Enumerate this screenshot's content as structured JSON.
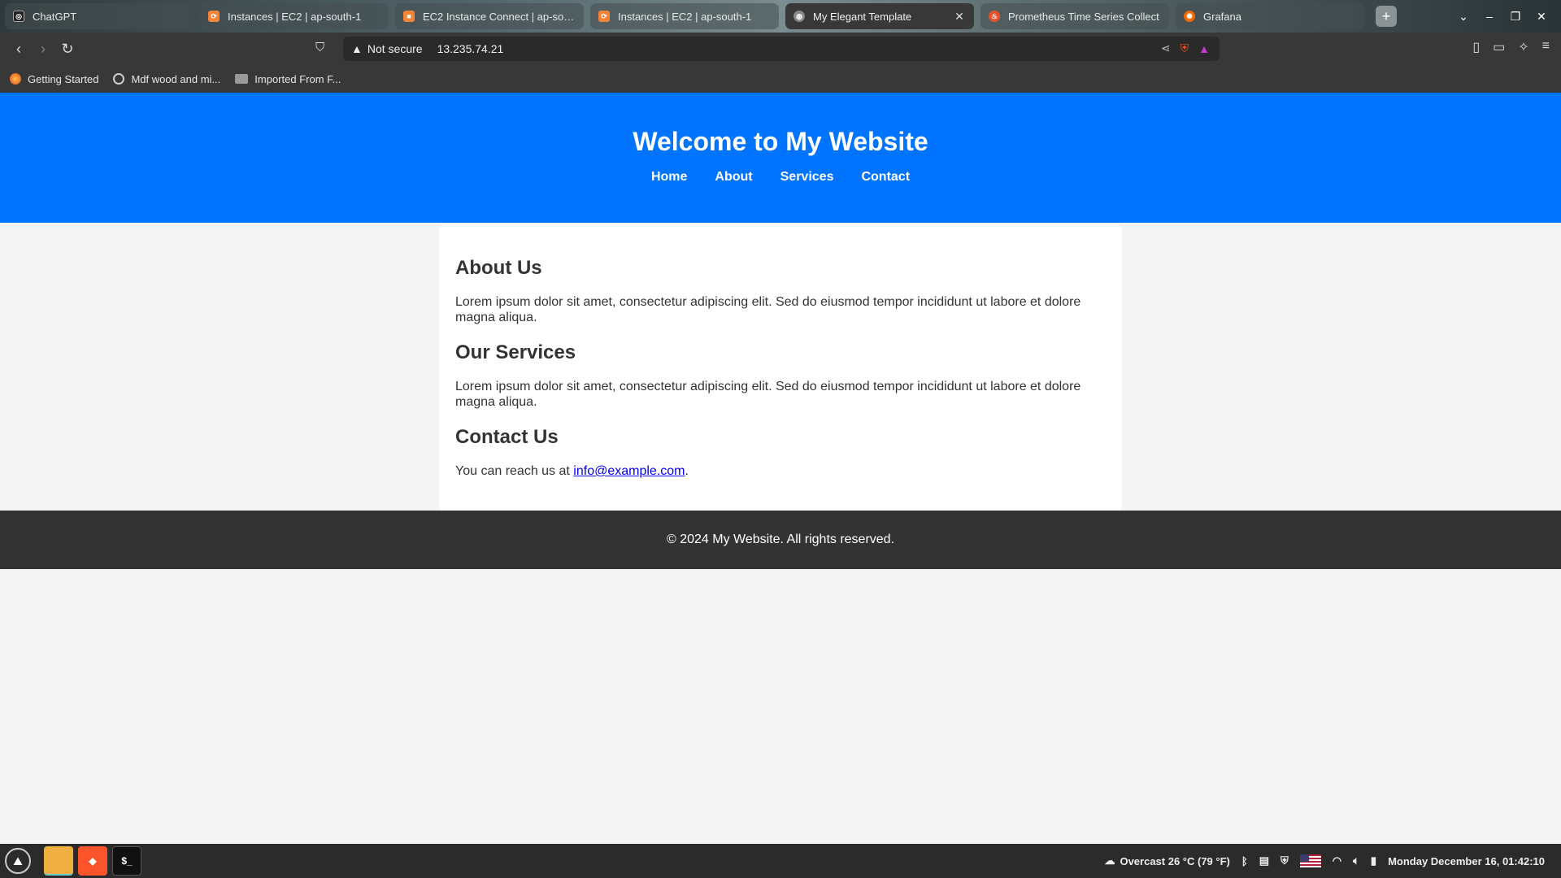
{
  "browser": {
    "tabs": [
      {
        "title": "ChatGPT",
        "favicon": "chatgpt-icon",
        "color": "#202020"
      },
      {
        "title": "Instances | EC2 | ap-south-1",
        "favicon": "aws-icon",
        "color": "#f58536"
      },
      {
        "title": "EC2 Instance Connect | ap-south-1",
        "favicon": "aws-cube-icon",
        "color": "#f58536"
      },
      {
        "title": "Instances | EC2 | ap-south-1",
        "favicon": "aws-icon",
        "color": "#f58536"
      },
      {
        "title": "My Elegant Template",
        "favicon": "globe-icon",
        "color": "#888888",
        "active": true
      },
      {
        "title": "Prometheus Time Series Collect",
        "favicon": "prometheus-icon",
        "color": "#e6522c"
      },
      {
        "title": "Grafana",
        "favicon": "grafana-icon",
        "color": "#f46800"
      }
    ],
    "new_tab": "+",
    "address": {
      "security": "Not secure",
      "url": "13.235.74.21"
    },
    "bookmarks": [
      {
        "label": "Getting Started",
        "icon": "firefox-icon"
      },
      {
        "label": "Mdf wood and mi...",
        "icon": "globe-icon"
      },
      {
        "label": "Imported From F...",
        "icon": "folder-icon"
      }
    ]
  },
  "page": {
    "title": "Welcome to My Website",
    "nav": [
      "Home",
      "About",
      "Services",
      "Contact"
    ],
    "about_heading": "About Us",
    "about_text": "Lorem ipsum dolor sit amet, consectetur adipiscing elit. Sed do eiusmod tempor incididunt ut labore et dolore magna aliqua.",
    "services_heading": "Our Services",
    "services_text": "Lorem ipsum dolor sit amet, consectetur adipiscing elit. Sed do eiusmod tempor incididunt ut labore et dolore magna aliqua.",
    "contact_heading": "Contact Us",
    "contact_prefix": "You can reach us at ",
    "contact_email": "info@example.com",
    "contact_suffix": ".",
    "footer": "© 2024 My Website. All rights reserved.",
    "colors": {
      "header": "#0073ff",
      "footer": "#333333",
      "background": "#f4f4f4"
    }
  },
  "taskbar": {
    "weather": "Overcast 26 °C (79 °F)",
    "datetime": "Monday December 16, 01:42:10"
  }
}
